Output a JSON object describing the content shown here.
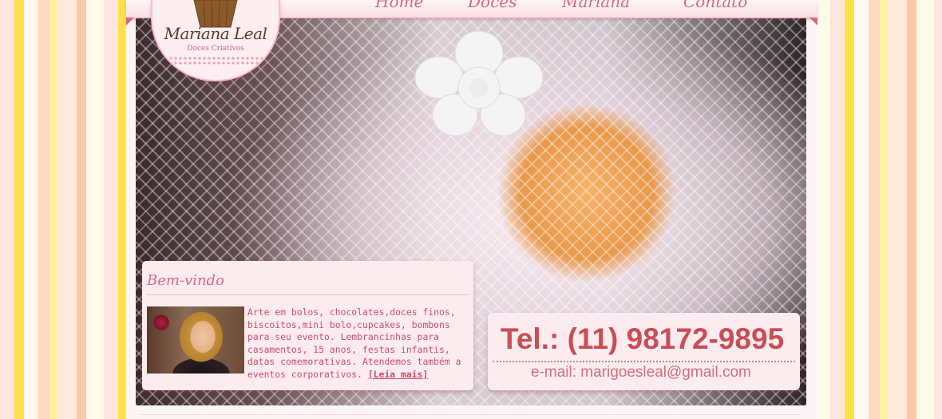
{
  "nav": {
    "items": [
      {
        "label": "Home"
      },
      {
        "label": "Doces"
      },
      {
        "label": "Mariana"
      },
      {
        "label": "Contato"
      }
    ]
  },
  "logo": {
    "name": "Mariana Leal",
    "tagline": "Doces Criativos"
  },
  "welcome": {
    "title": "Bem-vindo",
    "body": "Arte em bolos, chocolates,doces finos, biscoitos,mini bolo,cupcakes, bombons para seu evento. Lembrancinhas para casamentos, 15 anos, festas infantis, datas comemorativas. Atendemos também a eventos corporativos.",
    "read_more": "[Leia mais]"
  },
  "contact": {
    "phone": "Tel.: (11) 98172-9895",
    "email": "e-mail: marigoesleal@gmail.com"
  },
  "colors": {
    "accent": "#d9687f",
    "phone": "#c94e55",
    "panel": "#fdecef"
  }
}
